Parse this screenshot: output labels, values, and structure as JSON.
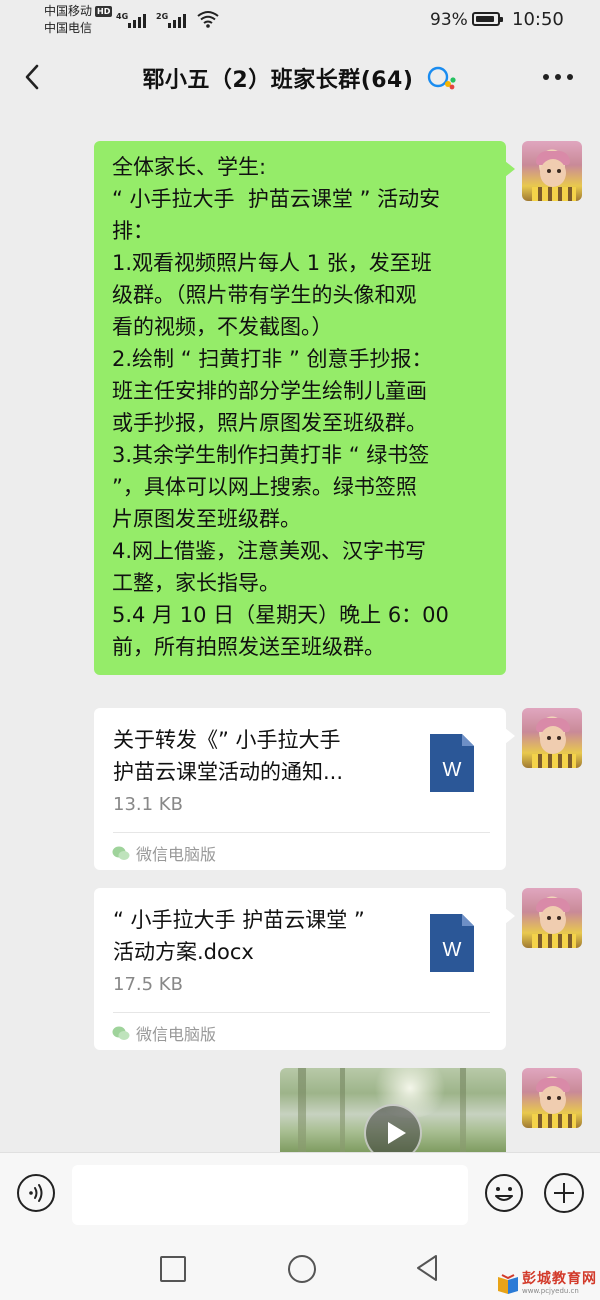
{
  "status_bar": {
    "carrier_1": "中国移动",
    "carrier_1_badge": "HD",
    "carrier_2": "中国电信",
    "signal_1_tag": "4G",
    "signal_2_tag": "2G",
    "battery_percent": "93%",
    "battery_level": 0.93,
    "time": "10:50"
  },
  "header": {
    "title": "郓小五（2）班家长群(64)",
    "back_icon": "chevron-left-icon",
    "more_icon": "more-dots-icon",
    "enterprise_icon": "wecom-icon"
  },
  "messages": {
    "notice": {
      "lines": [
        "全体家长、学生:",
        "“ 小手拉大手  护苗云课堂 ” 活动安",
        "排：",
        "1.观看视频照片每人 1 张，发至班",
        "级群。（照片带有学生的头像和观",
        "看的视频，不发截图。）",
        "2.绘制 “ 扫黄打非 ” 创意手抄报：",
        "班主任安排的部分学生绘制儿童画",
        "或手抄报，照片原图发至班级群。",
        "3.其余学生制作扫黄打非 “ 绿书签",
        "”，具体可以网上搜索。绿书签照",
        "片原图发至班级群。",
        "4.网上借鉴，注意美观、汉字书写",
        "工整，家长指导。",
        "5.4 月 10 日（星期天）晚上 6：00",
        "前，所有拍照发送至班级群。"
      ]
    },
    "file_1": {
      "name_line_1": "关于转发《” 小手拉大手",
      "name_line_2": "护苗云课堂活动的通知...",
      "size": "13.1 KB",
      "source": "微信电脑版",
      "icon_letter": "W"
    },
    "file_2": {
      "name_line_1": "“ 小手拉大手  护苗云课堂 ”",
      "name_line_2": "活动方案.docx",
      "size": "17.5 KB",
      "source": "微信电脑版",
      "icon_letter": "W"
    }
  },
  "input_bar": {
    "placeholder": ""
  },
  "watermark": {
    "title": "彭城教育网",
    "url": "www.pcjyedu.cn"
  },
  "colors": {
    "background": "#ededed",
    "bubble_green": "#95ec69",
    "word_blue": "#2b5797",
    "watermark_red": "#d23a2a"
  }
}
